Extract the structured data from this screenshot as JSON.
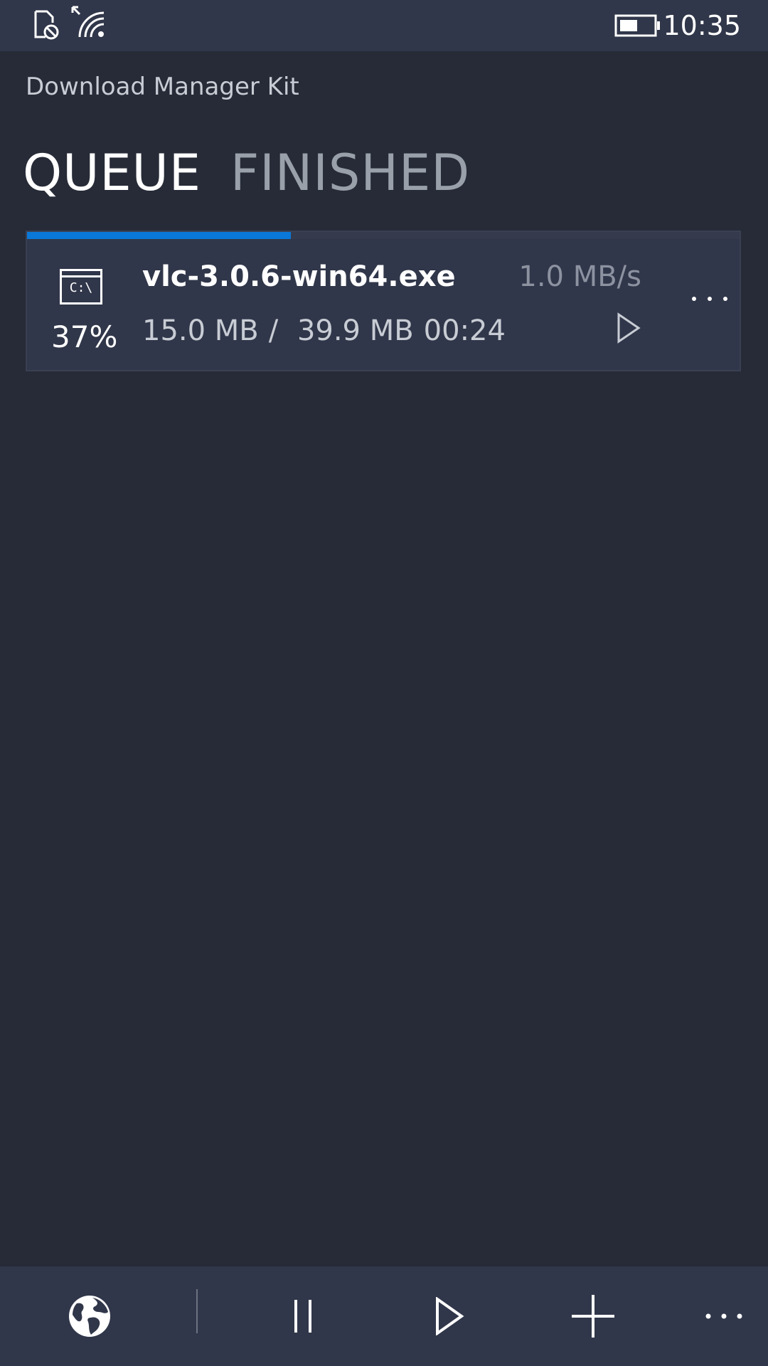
{
  "status_bar": {
    "time": "10:35",
    "icons": [
      "no-sim-icon",
      "wifi-icon",
      "battery-icon"
    ]
  },
  "app": {
    "title": "Download Manager Kit"
  },
  "tabs": [
    {
      "label": "QUEUE",
      "active": true
    },
    {
      "label": "FINISHED",
      "active": false
    }
  ],
  "downloads": [
    {
      "icon": "console-app-icon",
      "icon_text": "C:\\",
      "percent_label": "37%",
      "progress": 0.37,
      "filename": "vlc-3.0.6-win64.exe",
      "speed": "1.0 MB/s",
      "downloaded": "15.0 MB",
      "separator": "/",
      "total": "39.9 MB",
      "time_remaining": "00:24",
      "actions": [
        "play-icon",
        "more-icon"
      ]
    }
  ],
  "app_bar": {
    "buttons": [
      "globe-icon",
      "pause-icon",
      "play-icon",
      "add-icon",
      "more-icon"
    ]
  },
  "colors": {
    "background": "#262b37",
    "bar": "#31374a",
    "accent": "#0a78d8",
    "muted_text": "#8c92a0"
  }
}
